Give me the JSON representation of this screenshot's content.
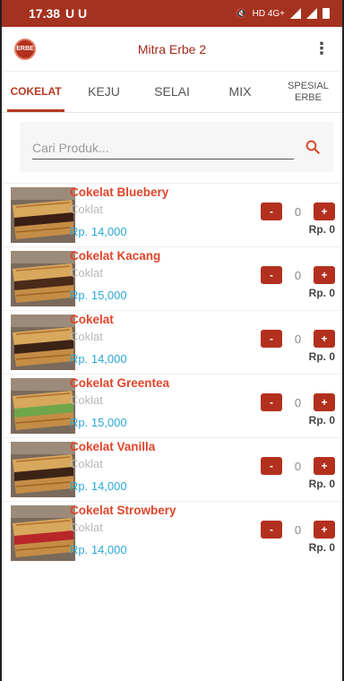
{
  "status_bar": {
    "time": "17.38",
    "left_icons": "U U",
    "right_text": "HD 4G+"
  },
  "app_bar": {
    "title": "Mitra Erbe 2",
    "logo_text": "ERBE",
    "menu_icon": "more-vert-icon"
  },
  "tabs": [
    {
      "label": "COKELAT",
      "active": true
    },
    {
      "label": "KEJU",
      "active": false
    },
    {
      "label": "SELAI",
      "active": false
    },
    {
      "label": "MIX",
      "active": false
    },
    {
      "label": "SPESIAL\nERBE",
      "active": false
    }
  ],
  "search": {
    "placeholder": "Cari Produk...",
    "value": ""
  },
  "products": [
    {
      "name": "Cokelat Bluebery",
      "category": "Coklat",
      "price": "Rp. 14,000",
      "qty": "0",
      "subtotal": "Rp. 0",
      "filling": "#3b1f14"
    },
    {
      "name": "Cokelat Kacang",
      "category": "Coklat",
      "price": "Rp. 15,000",
      "qty": "0",
      "subtotal": "Rp. 0",
      "filling": "#4a2a18"
    },
    {
      "name": "Cokelat",
      "category": "Coklat",
      "price": "Rp. 14,000",
      "qty": "0",
      "subtotal": "Rp. 0",
      "filling": "#3a2215"
    },
    {
      "name": "Cokelat Greentea",
      "category": "Coklat",
      "price": "Rp. 15,000",
      "qty": "0",
      "subtotal": "Rp. 0",
      "filling": "#6fa64a"
    },
    {
      "name": "Cokelat Vanilla",
      "category": "Coklat",
      "price": "Rp. 14,000",
      "qty": "0",
      "subtotal": "Rp. 0",
      "filling": "#3d2316"
    },
    {
      "name": "Cokelat Strowbery",
      "category": "Coklat",
      "price": "Rp. 14,000",
      "qty": "0",
      "subtotal": "Rp. 0",
      "filling": "#b8262a"
    }
  ],
  "stepper": {
    "minus": "-",
    "plus": "+"
  },
  "colors": {
    "primary": "#b3301e",
    "product_name": "#e0452a",
    "price": "#2ba8d8"
  }
}
